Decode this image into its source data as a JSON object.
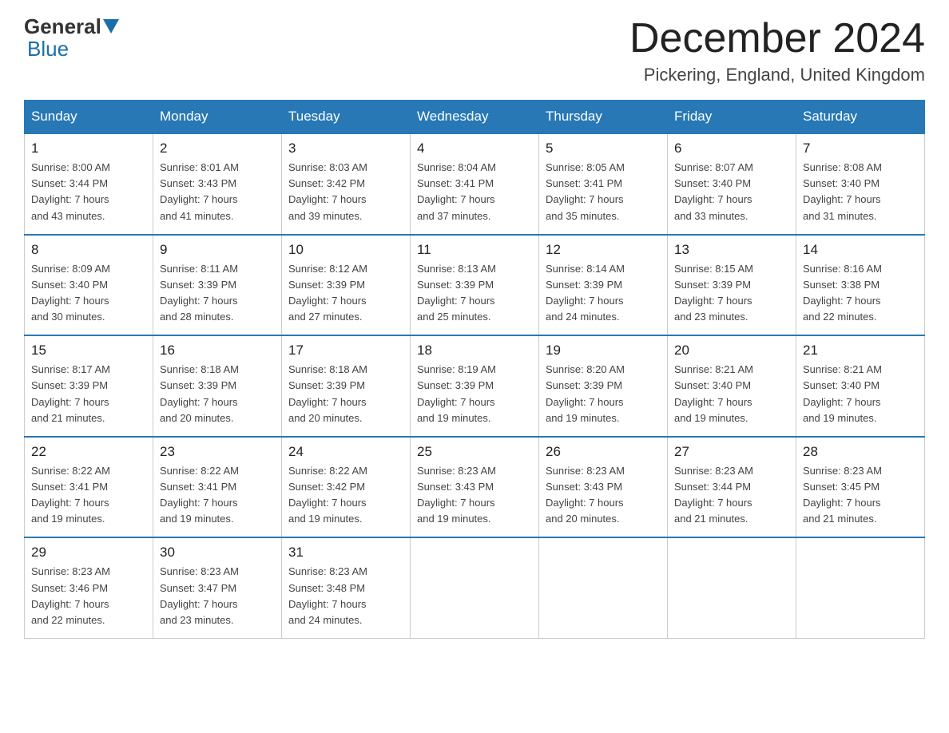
{
  "header": {
    "logo_general": "General",
    "logo_blue": "Blue",
    "month_title": "December 2024",
    "location": "Pickering, England, United Kingdom"
  },
  "days_of_week": [
    "Sunday",
    "Monday",
    "Tuesday",
    "Wednesday",
    "Thursday",
    "Friday",
    "Saturday"
  ],
  "weeks": [
    [
      {
        "num": "1",
        "sunrise": "8:00 AM",
        "sunset": "3:44 PM",
        "daylight": "7 hours and 43 minutes."
      },
      {
        "num": "2",
        "sunrise": "8:01 AM",
        "sunset": "3:43 PM",
        "daylight": "7 hours and 41 minutes."
      },
      {
        "num": "3",
        "sunrise": "8:03 AM",
        "sunset": "3:42 PM",
        "daylight": "7 hours and 39 minutes."
      },
      {
        "num": "4",
        "sunrise": "8:04 AM",
        "sunset": "3:41 PM",
        "daylight": "7 hours and 37 minutes."
      },
      {
        "num": "5",
        "sunrise": "8:05 AM",
        "sunset": "3:41 PM",
        "daylight": "7 hours and 35 minutes."
      },
      {
        "num": "6",
        "sunrise": "8:07 AM",
        "sunset": "3:40 PM",
        "daylight": "7 hours and 33 minutes."
      },
      {
        "num": "7",
        "sunrise": "8:08 AM",
        "sunset": "3:40 PM",
        "daylight": "7 hours and 31 minutes."
      }
    ],
    [
      {
        "num": "8",
        "sunrise": "8:09 AM",
        "sunset": "3:40 PM",
        "daylight": "7 hours and 30 minutes."
      },
      {
        "num": "9",
        "sunrise": "8:11 AM",
        "sunset": "3:39 PM",
        "daylight": "7 hours and 28 minutes."
      },
      {
        "num": "10",
        "sunrise": "8:12 AM",
        "sunset": "3:39 PM",
        "daylight": "7 hours and 27 minutes."
      },
      {
        "num": "11",
        "sunrise": "8:13 AM",
        "sunset": "3:39 PM",
        "daylight": "7 hours and 25 minutes."
      },
      {
        "num": "12",
        "sunrise": "8:14 AM",
        "sunset": "3:39 PM",
        "daylight": "7 hours and 24 minutes."
      },
      {
        "num": "13",
        "sunrise": "8:15 AM",
        "sunset": "3:39 PM",
        "daylight": "7 hours and 23 minutes."
      },
      {
        "num": "14",
        "sunrise": "8:16 AM",
        "sunset": "3:38 PM",
        "daylight": "7 hours and 22 minutes."
      }
    ],
    [
      {
        "num": "15",
        "sunrise": "8:17 AM",
        "sunset": "3:39 PM",
        "daylight": "7 hours and 21 minutes."
      },
      {
        "num": "16",
        "sunrise": "8:18 AM",
        "sunset": "3:39 PM",
        "daylight": "7 hours and 20 minutes."
      },
      {
        "num": "17",
        "sunrise": "8:18 AM",
        "sunset": "3:39 PM",
        "daylight": "7 hours and 20 minutes."
      },
      {
        "num": "18",
        "sunrise": "8:19 AM",
        "sunset": "3:39 PM",
        "daylight": "7 hours and 19 minutes."
      },
      {
        "num": "19",
        "sunrise": "8:20 AM",
        "sunset": "3:39 PM",
        "daylight": "7 hours and 19 minutes."
      },
      {
        "num": "20",
        "sunrise": "8:21 AM",
        "sunset": "3:40 PM",
        "daylight": "7 hours and 19 minutes."
      },
      {
        "num": "21",
        "sunrise": "8:21 AM",
        "sunset": "3:40 PM",
        "daylight": "7 hours and 19 minutes."
      }
    ],
    [
      {
        "num": "22",
        "sunrise": "8:22 AM",
        "sunset": "3:41 PM",
        "daylight": "7 hours and 19 minutes."
      },
      {
        "num": "23",
        "sunrise": "8:22 AM",
        "sunset": "3:41 PM",
        "daylight": "7 hours and 19 minutes."
      },
      {
        "num": "24",
        "sunrise": "8:22 AM",
        "sunset": "3:42 PM",
        "daylight": "7 hours and 19 minutes."
      },
      {
        "num": "25",
        "sunrise": "8:23 AM",
        "sunset": "3:43 PM",
        "daylight": "7 hours and 19 minutes."
      },
      {
        "num": "26",
        "sunrise": "8:23 AM",
        "sunset": "3:43 PM",
        "daylight": "7 hours and 20 minutes."
      },
      {
        "num": "27",
        "sunrise": "8:23 AM",
        "sunset": "3:44 PM",
        "daylight": "7 hours and 21 minutes."
      },
      {
        "num": "28",
        "sunrise": "8:23 AM",
        "sunset": "3:45 PM",
        "daylight": "7 hours and 21 minutes."
      }
    ],
    [
      {
        "num": "29",
        "sunrise": "8:23 AM",
        "sunset": "3:46 PM",
        "daylight": "7 hours and 22 minutes."
      },
      {
        "num": "30",
        "sunrise": "8:23 AM",
        "sunset": "3:47 PM",
        "daylight": "7 hours and 23 minutes."
      },
      {
        "num": "31",
        "sunrise": "8:23 AM",
        "sunset": "3:48 PM",
        "daylight": "7 hours and 24 minutes."
      },
      null,
      null,
      null,
      null
    ]
  ],
  "labels": {
    "sunrise": "Sunrise:",
    "sunset": "Sunset:",
    "daylight": "Daylight:"
  }
}
